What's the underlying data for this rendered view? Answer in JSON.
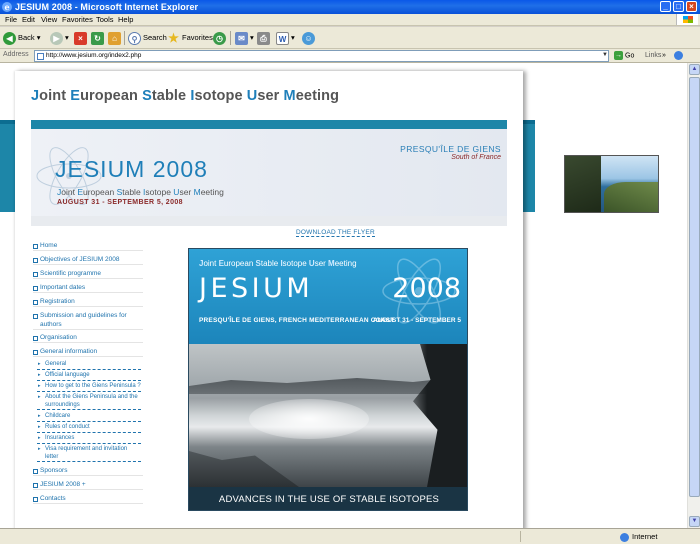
{
  "window": {
    "title": "JESIUM 2008 - Microsoft Internet Explorer",
    "minimize_icon": "minimize-icon",
    "maximize_icon": "maximize-icon",
    "close_icon": "close-icon"
  },
  "menu": [
    "File",
    "Edit",
    "View",
    "Favorites",
    "Tools",
    "Help"
  ],
  "toolbar": {
    "back": "Back",
    "search": "Search",
    "favorites": "Favorites"
  },
  "address": {
    "label": "Address",
    "url": "http://www.jesium.org/index2.php",
    "go": "Go",
    "links": "Links"
  },
  "site": {
    "title_parts": [
      {
        "cap": "J",
        "rest": "oint "
      },
      {
        "cap": "E",
        "rest": "uropean "
      },
      {
        "cap": "S",
        "rest": "table "
      },
      {
        "cap": "I",
        "rest": "sotope "
      },
      {
        "cap": "U",
        "rest": "ser "
      },
      {
        "cap": "M",
        "rest": "eeting"
      }
    ]
  },
  "banner": {
    "place": "PRESQU'ÎLE DE GIENS",
    "country": "South of France",
    "title": "JESIUM 2008",
    "subtitle_parts": [
      {
        "cap": "J",
        "rest": "oint "
      },
      {
        "cap": "E",
        "rest": "uropean "
      },
      {
        "cap": "S",
        "rest": "table "
      },
      {
        "cap": "I",
        "rest": "sotope "
      },
      {
        "cap": "U",
        "rest": "ser "
      },
      {
        "cap": "M",
        "rest": "eeting"
      }
    ],
    "dates": "AUGUST 31 - SEPTEMBER 5, 2008"
  },
  "nav": {
    "items": [
      "Home",
      "Objectives of JESIUM 2008",
      "Scientific programme",
      "Important dates",
      "Registration",
      "Submission and guidelines for authors",
      "Organisation",
      "General information"
    ],
    "sub_items": [
      "General",
      "Official language",
      "How to get to the Giens Peninsula ?",
      "About the Giens Peninsula and the surroundings",
      "Childcare",
      "Rules of conduct",
      "Insurances",
      "Visa requirement and invitation letter"
    ],
    "items_after": [
      "Sponsors",
      "JESIUM 2008 +",
      "Contacts"
    ]
  },
  "flyer": {
    "download_label": "DOWNLOAD THE FLYER",
    "subtitle_parts": [
      {
        "cap": "J",
        "rest": "oint "
      },
      {
        "cap": "E",
        "rest": "uropean "
      },
      {
        "cap": "S",
        "rest": "table "
      },
      {
        "cap": "I",
        "rest": "sotope "
      },
      {
        "cap": "U",
        "rest": "ser "
      },
      {
        "cap": "M",
        "rest": "eeting"
      }
    ],
    "title": "JESIUM",
    "year": "2008",
    "place": "PRESQU'ÎLE DE GIENS, FRENCH MEDITERRANEAN COAST",
    "dates": "AUGUST 31 - SEPTEMBER 5",
    "tagline": "ADVANCES IN THE USE OF STABLE ISOTOPES"
  },
  "status": {
    "zone": "Internet"
  }
}
